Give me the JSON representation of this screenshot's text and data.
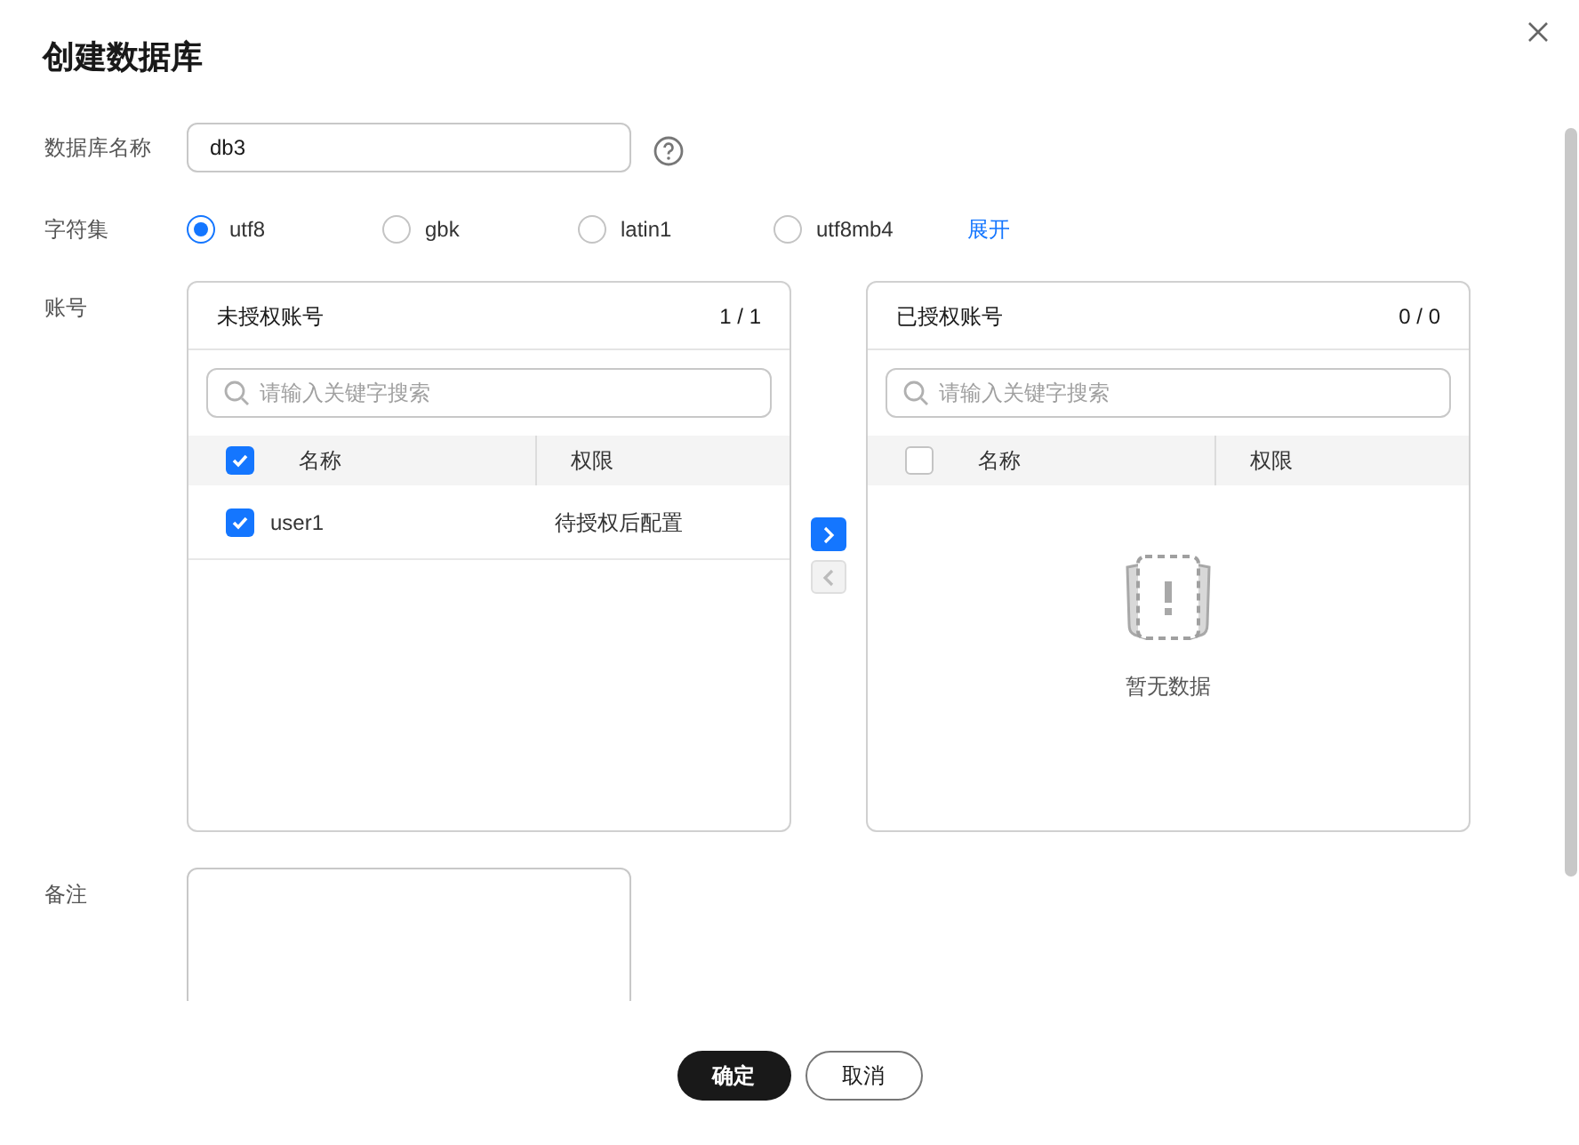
{
  "dialog": {
    "title": "创建数据库"
  },
  "name_field": {
    "label": "数据库名称",
    "value": "db3"
  },
  "charset": {
    "label": "字符集",
    "options": [
      {
        "label": "utf8",
        "selected": true
      },
      {
        "label": "gbk",
        "selected": false
      },
      {
        "label": "latin1",
        "selected": false
      },
      {
        "label": "utf8mb4",
        "selected": false
      }
    ],
    "expand_link": "展开"
  },
  "accounts": {
    "label": "账号",
    "panels": [
      {
        "title": "未授权账号",
        "count": "1 / 1",
        "search_placeholder": "请输入关键字搜索",
        "columns": [
          "名称",
          "权限"
        ],
        "all_checked": true,
        "rows": [
          {
            "name": "user1",
            "permission": "待授权后配置",
            "checked": true
          }
        ]
      },
      {
        "title": "已授权账号",
        "count": "0 / 0",
        "search_placeholder": "请输入关键字搜索",
        "columns": [
          "名称",
          "权限"
        ],
        "all_checked": false,
        "empty_text": "暂无数据"
      }
    ],
    "transfer_buttons": [
      {
        "kind": "right",
        "disabled": false
      },
      {
        "kind": "left",
        "disabled": true
      }
    ]
  },
  "remarks": {
    "label": "备注"
  },
  "buttons": [
    {
      "label": "确定",
      "kind": "primary"
    },
    {
      "label": "取消",
      "kind": "secondary"
    }
  ]
}
